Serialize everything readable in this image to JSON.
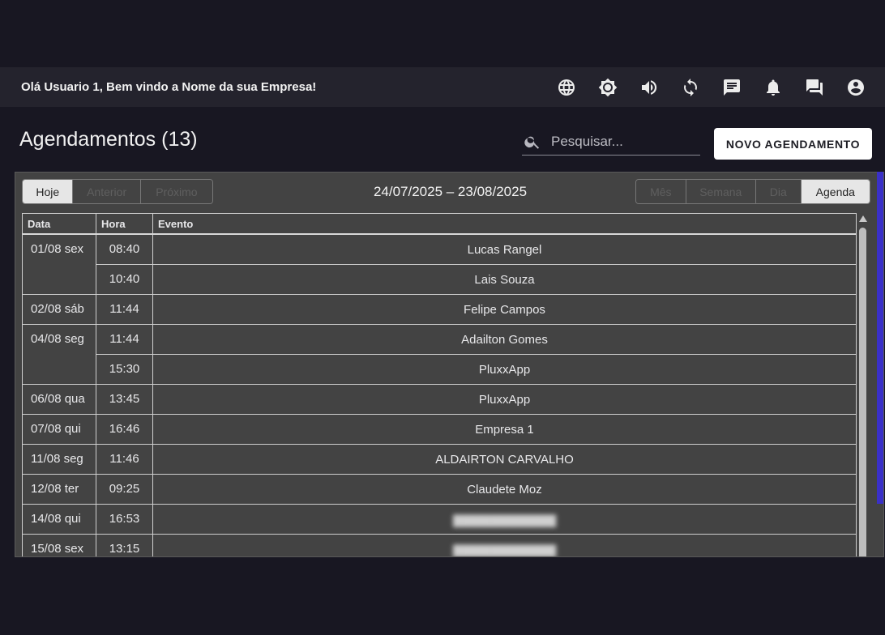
{
  "header": {
    "greeting": "Olá Usuario 1, Bem vindo a Nome da sua Empresa!",
    "icons": [
      "globe-icon",
      "brightness-icon",
      "volume-icon",
      "sync-icon",
      "message-icon",
      "bell-icon",
      "forum-icon",
      "account-icon"
    ]
  },
  "page": {
    "title": "Agendamentos (13)",
    "search_placeholder": "Pesquisar...",
    "new_button": "NOVO AGENDAMENTO"
  },
  "calendar": {
    "nav": {
      "today": "Hoje",
      "prev": "Anterior",
      "next": "Próximo"
    },
    "date_range": "24/07/2025 – 23/08/2025",
    "views": {
      "month": "Mês",
      "week": "Semana",
      "day": "Dia",
      "agenda": "Agenda"
    },
    "columns": {
      "date": "Data",
      "time": "Hora",
      "event": "Evento"
    },
    "rows": [
      {
        "date": "01/08 sex",
        "time": "08:40",
        "event": "Lucas Rangel"
      },
      {
        "date": "",
        "time": "10:40",
        "event": "Lais Souza"
      },
      {
        "date": "02/08 sáb",
        "time": "11:44",
        "event": "Felipe Campos"
      },
      {
        "date": "04/08 seg",
        "time": "11:44",
        "event": "Adailton Gomes"
      },
      {
        "date": "",
        "time": "15:30",
        "event": "PluxxApp"
      },
      {
        "date": "06/08 qua",
        "time": "13:45",
        "event": "PluxxApp"
      },
      {
        "date": "07/08 qui",
        "time": "16:46",
        "event": "Empresa 1"
      },
      {
        "date": "11/08 seg",
        "time": "11:46",
        "event": "ALDAIRTON CARVALHO"
      },
      {
        "date": "12/08 ter",
        "time": "09:25",
        "event": "Claudete Moz"
      },
      {
        "date": "14/08 qui",
        "time": "16:53",
        "event": ""
      },
      {
        "date": "15/08 sex",
        "time": "13:15",
        "event": ""
      }
    ]
  },
  "colors": {
    "background": "#181722",
    "topbar": "#24232d",
    "panel": "#434343",
    "accent": "#3a30c8"
  }
}
